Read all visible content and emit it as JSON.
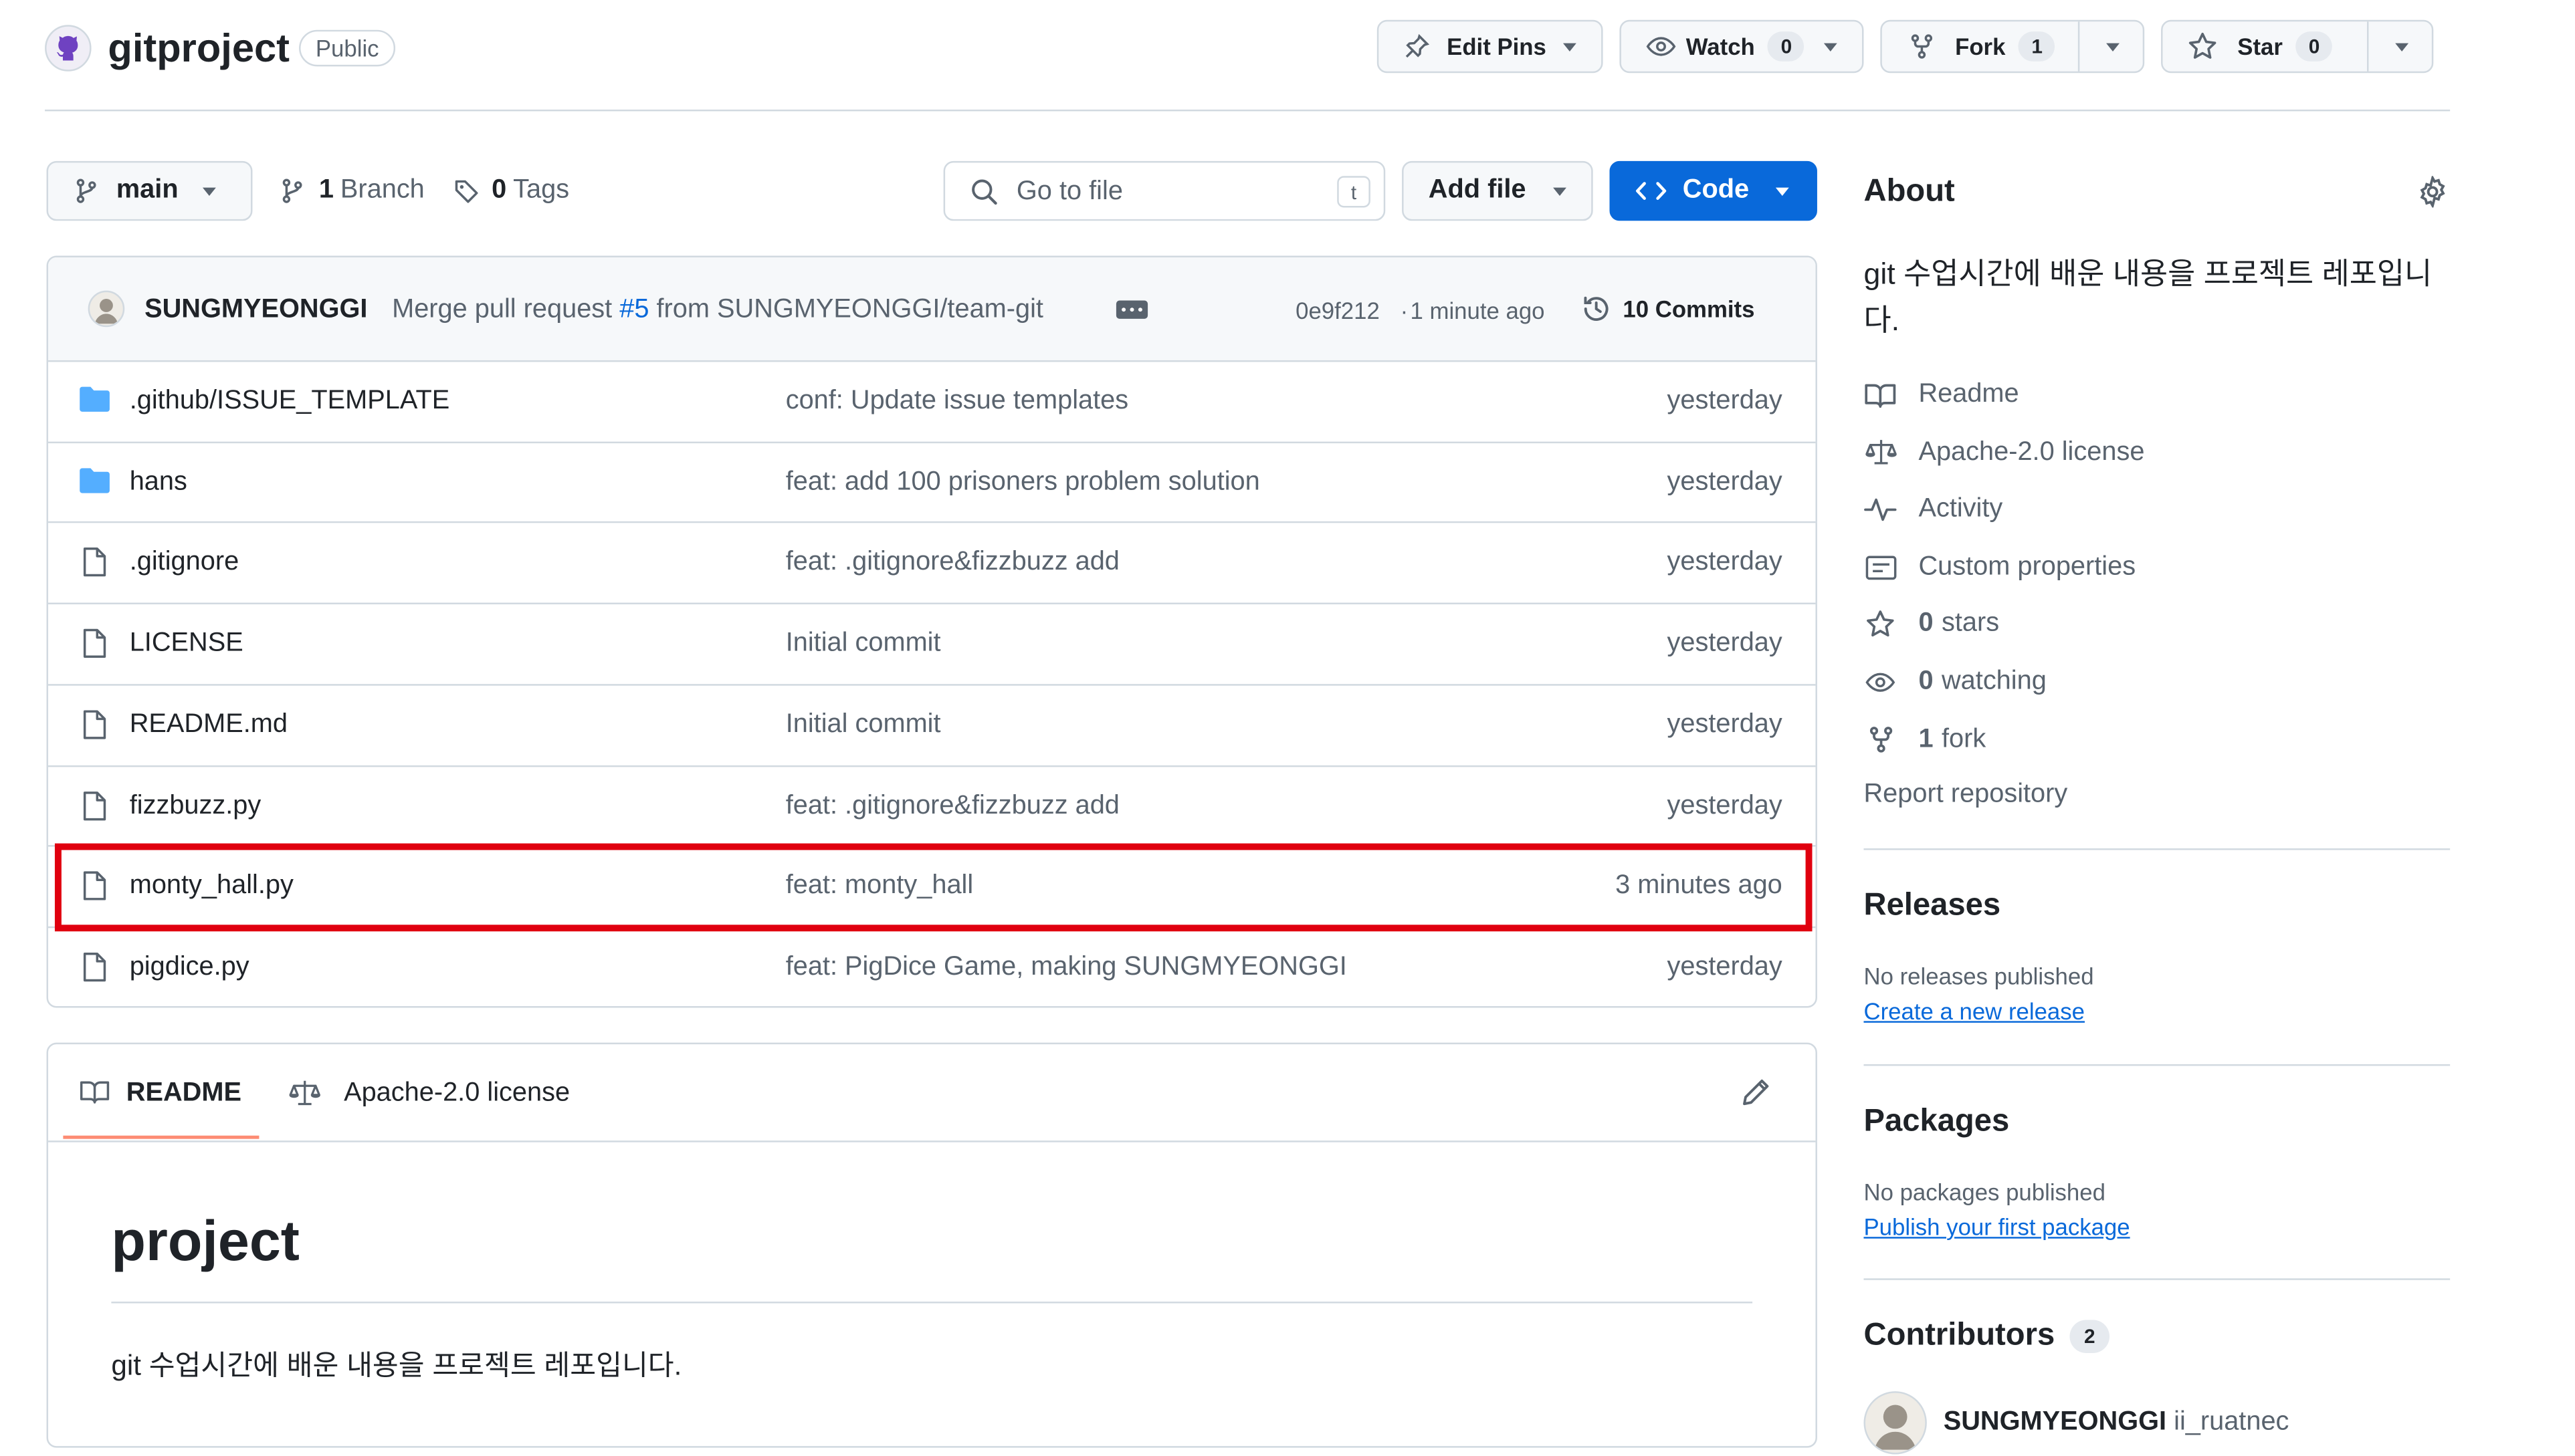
{
  "repo": {
    "name": "gitproject",
    "visibility": "Public"
  },
  "actions": {
    "edit_pins": "Edit Pins",
    "watch": "Watch",
    "watch_count": "0",
    "fork": "Fork",
    "fork_count": "1",
    "star": "Star",
    "star_count": "0"
  },
  "toolbar": {
    "branch": "main",
    "branch_count": "1",
    "branch_label": "Branch",
    "tag_count": "0",
    "tag_label": "Tags",
    "go_to_file_placeholder": "Go to file",
    "go_to_file_shortcut": "t",
    "add_file": "Add file",
    "code": "Code"
  },
  "commit": {
    "author": "SUNGMYEONGGI",
    "message_prefix": "Merge pull request ",
    "pr_link": "#5",
    "message_suffix": " from SUNGMYEONGGI/team-git",
    "hash": "0e9f212",
    "time": "1 minute ago",
    "commits_count": "10 Commits"
  },
  "files": [
    {
      "type": "folder",
      "name": ".github/ISSUE_TEMPLATE",
      "message": "conf: Update issue templates",
      "date": "yesterday"
    },
    {
      "type": "folder",
      "name": "hans",
      "message": "feat: add 100 prisoners problem solution",
      "date": "yesterday"
    },
    {
      "type": "file",
      "name": ".gitignore",
      "message": "feat: .gitignore&fizzbuzz add",
      "date": "yesterday"
    },
    {
      "type": "file",
      "name": "LICENSE",
      "message": "Initial commit",
      "date": "yesterday"
    },
    {
      "type": "file",
      "name": "README.md",
      "message": "Initial commit",
      "date": "yesterday"
    },
    {
      "type": "file",
      "name": "fizzbuzz.py",
      "message": "feat: .gitignore&fizzbuzz add",
      "date": "yesterday"
    },
    {
      "type": "file",
      "name": "monty_hall.py",
      "message": "feat: monty_hall",
      "date": "3 minutes ago",
      "highlighted": true
    },
    {
      "type": "file",
      "name": "pigdice.py",
      "message": "feat: PigDice Game, making SUNGMYEONGGI",
      "date": "yesterday"
    }
  ],
  "readme": {
    "tab_readme": "README",
    "tab_license": "Apache-2.0 license",
    "heading": "project",
    "body": "git 수업시간에 배운 내용을 프로젝트 레포입니다."
  },
  "about": {
    "title": "About",
    "description": "git 수업시간에 배운 내용을 프로젝트 레포입니다.",
    "items": [
      {
        "icon": "book-icon",
        "label": "Readme"
      },
      {
        "icon": "scale-icon",
        "label": "Apache-2.0 license"
      },
      {
        "icon": "pulse-icon",
        "label": "Activity"
      },
      {
        "icon": "note-icon",
        "label": "Custom properties"
      },
      {
        "icon": "star-icon",
        "bold": "0",
        "label": "stars"
      },
      {
        "icon": "eye-icon",
        "bold": "0",
        "label": "watching"
      },
      {
        "icon": "fork-icon",
        "bold": "1",
        "label": "fork"
      }
    ],
    "report": "Report repository"
  },
  "releases": {
    "title": "Releases",
    "empty": "No releases published",
    "link": "Create a new release"
  },
  "packages": {
    "title": "Packages",
    "empty": "No packages published",
    "link": "Publish your first package"
  },
  "contributors": {
    "title": "Contributors",
    "count": "2",
    "names": [
      "SUNGMYEONGGI",
      "ii_ruatnec"
    ]
  },
  "colors": {
    "accent": "#0969da",
    "primary_button": "#0969da",
    "highlight_border": "#e0000f",
    "border": "#d1d9e0",
    "muted_text": "#59636e",
    "folder": "#54aeff"
  }
}
